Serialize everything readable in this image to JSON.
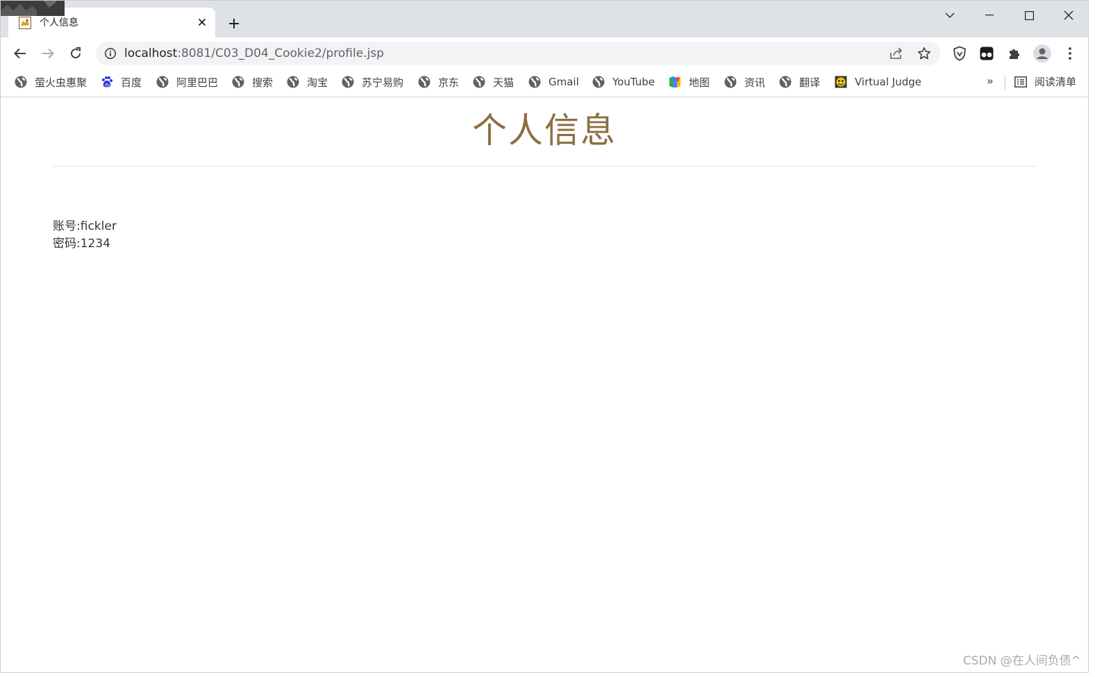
{
  "browser": {
    "tab": {
      "title": "个人信息",
      "favicon": "tomcat-icon"
    },
    "address_bar": {
      "host": "localhost",
      "path": ":8081/C03_D04_Cookie2/profile.jsp"
    },
    "bookmarks": [
      {
        "label": "萤火虫惠聚",
        "icon": "globe-icon"
      },
      {
        "label": "百度",
        "icon": "baidu-icon"
      },
      {
        "label": "阿里巴巴",
        "icon": "globe-icon"
      },
      {
        "label": "搜索",
        "icon": "globe-icon"
      },
      {
        "label": "淘宝",
        "icon": "globe-icon"
      },
      {
        "label": "苏宁易购",
        "icon": "globe-icon"
      },
      {
        "label": "京东",
        "icon": "globe-icon"
      },
      {
        "label": "天猫",
        "icon": "globe-icon"
      },
      {
        "label": "Gmail",
        "icon": "globe-icon"
      },
      {
        "label": "YouTube",
        "icon": "globe-icon"
      },
      {
        "label": "地图",
        "icon": "maps-icon"
      },
      {
        "label": "资讯",
        "icon": "globe-icon"
      },
      {
        "label": "翻译",
        "icon": "globe-icon"
      },
      {
        "label": "Virtual Judge",
        "icon": "virtual-judge-icon"
      }
    ],
    "bookmarks_more": "»",
    "reading_list": "阅读清单"
  },
  "page": {
    "heading": "个人信息",
    "account_label": "账号:",
    "account_value": "fickler",
    "password_label": "密码:",
    "password_value": "1234"
  },
  "watermark": "CSDN @在人间负债^",
  "colors": {
    "heading": "#8c6f42",
    "tabstrip": "#dee1e6",
    "omnibox": "#f1f3f4"
  }
}
